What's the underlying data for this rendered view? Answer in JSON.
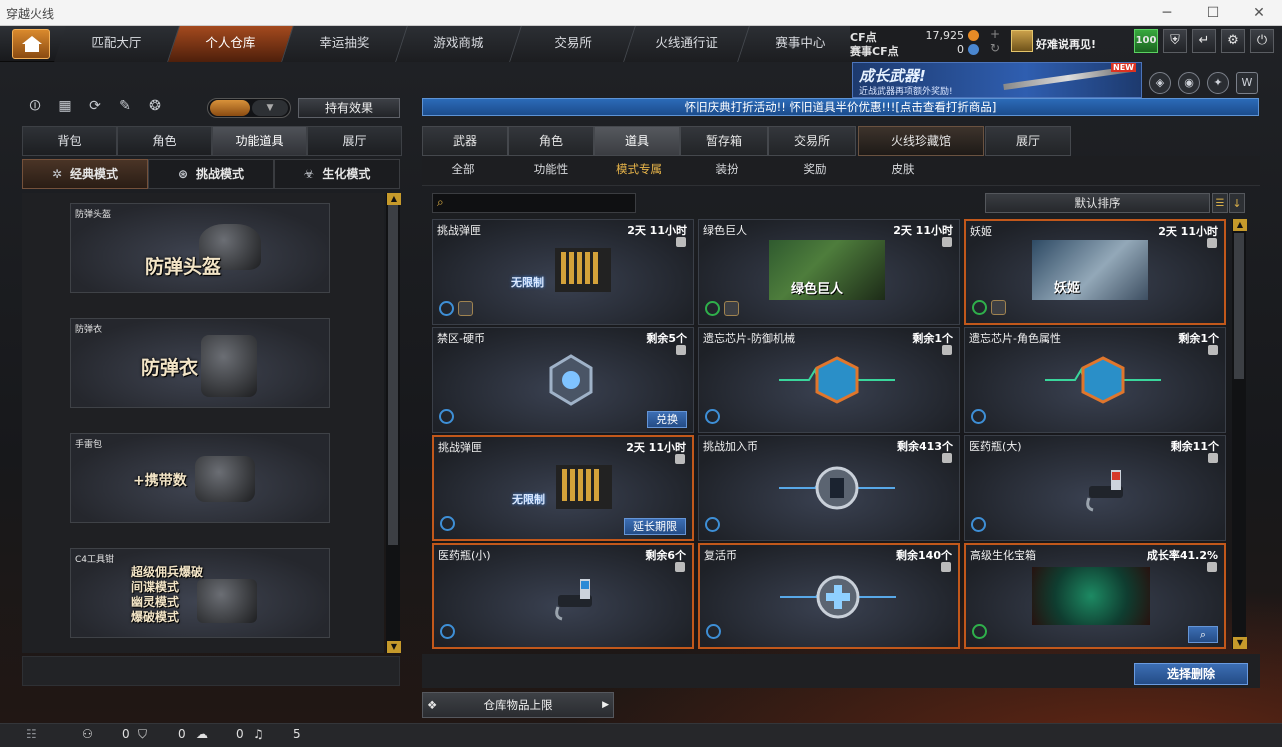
{
  "window": {
    "title": "穿越火线",
    "controls": [
      "─",
      "☐",
      "✕"
    ]
  },
  "nav": {
    "tabs": [
      "匹配大厅",
      "个人仓库",
      "幸运抽奖",
      "游戏商城",
      "交易所",
      "火线通行证",
      "赛事中心"
    ],
    "active": "个人仓库"
  },
  "currency": {
    "cf_label": "CF点",
    "cf_value": "17,925",
    "match_label": "赛事CF点",
    "match_value": "0"
  },
  "user": {
    "name": "好难说再见!",
    "level_badge": "100"
  },
  "banner": {
    "title": "成长武器!",
    "subtitle": "近战武器再项额外奖励!",
    "tag": "NEW"
  },
  "effects_button": "持有效果",
  "left": {
    "tabs": [
      "背包",
      "角色",
      "功能道具",
      "展厅"
    ],
    "active_tab": "功能道具",
    "modes": [
      "经典模式",
      "挑战模式",
      "生化模式"
    ],
    "active_mode": "经典模式",
    "cards": [
      {
        "name": "防弹头盔",
        "big": "防弹头盔"
      },
      {
        "name": "防弹衣",
        "big": "防弹衣"
      },
      {
        "name": "手雷包",
        "big": "+携带数"
      },
      {
        "name": "C4工具钳",
        "lines": [
          "超级佣兵爆破",
          "间谍模式",
          "幽灵模式",
          "爆破模式"
        ]
      }
    ]
  },
  "notice": "怀旧庆典打折活动!! 怀旧道具半价优惠!!![点击查看打折商品]",
  "right": {
    "tabs": [
      "武器",
      "角色",
      "道具",
      "暂存箱",
      "交易所",
      "火线珍藏馆",
      "展厅"
    ],
    "active_tab": "道具",
    "subtabs": [
      "全部",
      "功能性",
      "模式专属",
      "装扮",
      "奖励",
      "皮肤"
    ],
    "active_subtab": "模式专属",
    "search_placeholder": "",
    "sort_label": "默认排序",
    "items": [
      {
        "name": "挑战弹匣",
        "stat": "2天 11小时",
        "label": "无限制"
      },
      {
        "name": "绿色巨人",
        "stat": "2天 11小时",
        "label": "绿色巨人"
      },
      {
        "name": "妖姬",
        "stat": "2天 11小时",
        "label": "妖姬"
      },
      {
        "name": "禁区-硬币",
        "stat": "剩余5个",
        "button": "兑换"
      },
      {
        "name": "遗忘芯片-防御机械",
        "stat": "剩余1个"
      },
      {
        "name": "遗忘芯片-角色属性",
        "stat": "剩余1个"
      },
      {
        "name": "挑战弹匣",
        "stat": "2天 11小时",
        "label": "无限制",
        "button": "延长期限"
      },
      {
        "name": "挑战加入币",
        "stat": "剩余413个"
      },
      {
        "name": "医药瓶(大)",
        "stat": "剩余11个"
      },
      {
        "name": "医药瓶(小)",
        "stat": "剩余6个"
      },
      {
        "name": "复活币",
        "stat": "剩余140个"
      },
      {
        "name": "高级生化宝箱",
        "stat": "成长率41.2%"
      }
    ],
    "delete_button": "选择删除",
    "capacity_label": "仓库物品上限"
  },
  "status": {
    "friends": "0",
    "shield": "0",
    "chat": "0",
    "volume": "5"
  },
  "colors": {
    "accent_orange": "#c2581b",
    "blue_button": "#2f5fa3",
    "gold": "#e7b449"
  }
}
